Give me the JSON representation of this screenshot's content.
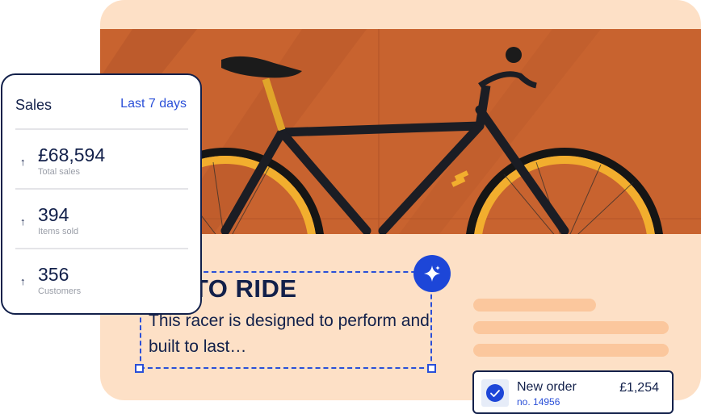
{
  "hero": {
    "headline": "RN TO RIDE",
    "body": "This racer is designed to perform and built to last…"
  },
  "sales": {
    "title": "Sales",
    "range": "Last 7 days",
    "metrics": [
      {
        "value": "£68,594",
        "label": "Total sales",
        "icon": "arrow-up-icon"
      },
      {
        "value": "394",
        "label": "Items sold",
        "icon": "arrow-up-icon"
      },
      {
        "value": "356",
        "label": "Customers",
        "icon": "arrow-up-icon"
      }
    ]
  },
  "order": {
    "title": "New order",
    "number": "no. 14956",
    "amount": "£1,254"
  },
  "colors": {
    "accent": "#1d46d8",
    "navy": "#12204a",
    "peach": "#fde0c6",
    "wall": "#c8632f",
    "tire": "#f2ae2e"
  },
  "icons": {
    "ai_button": "sparkle-icon",
    "order_status": "check-circle-icon",
    "metric_arrow": "arrow-up-icon"
  }
}
